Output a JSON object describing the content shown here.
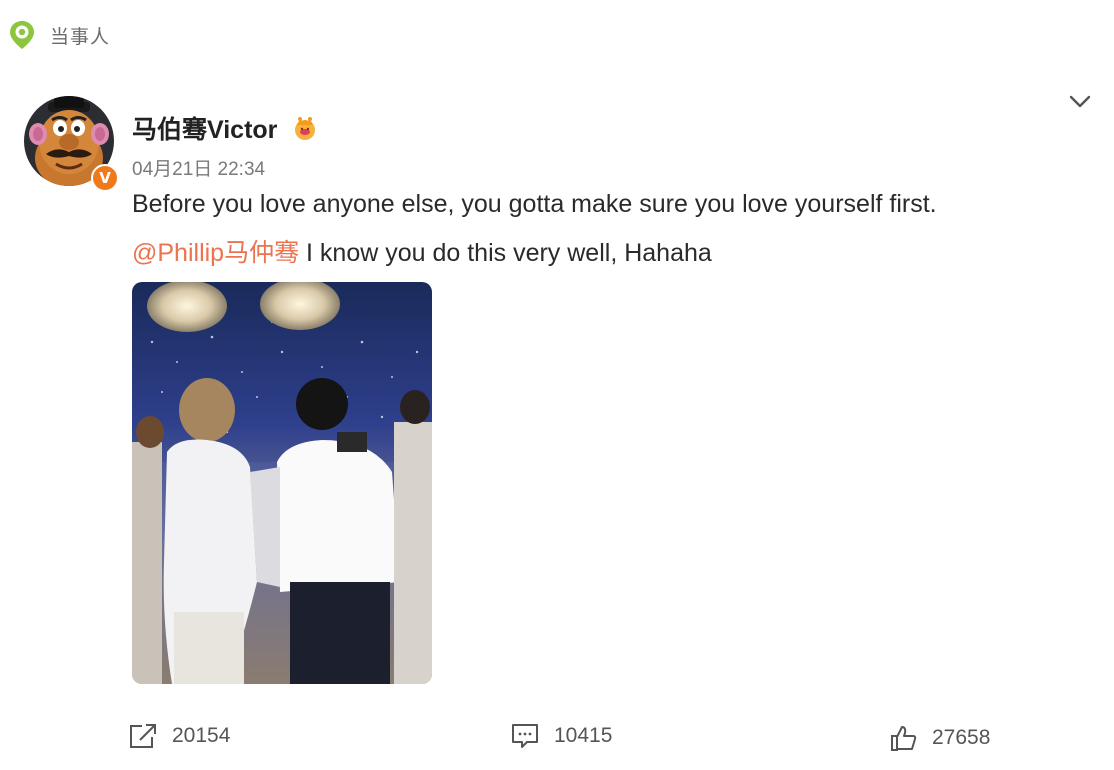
{
  "header": {
    "label": "当事人",
    "location_icon": "location-pin-icon"
  },
  "post": {
    "author": "马伯骞Victor",
    "verified_badge": "V",
    "timestamp": "04月21日 22:34",
    "text_line1": "Before you love anyone else, you gotta make sure you love yourself first.",
    "mention": "@Phillip马仲骞",
    "text_line2": " I know you do this very well, Hahaha"
  },
  "actions": {
    "repost_count": "20154",
    "comment_count": "10415",
    "like_count": "27658"
  },
  "colors": {
    "mention": "#eb7350",
    "badge": "#f07a1a",
    "location_icon": "#8cc63f"
  }
}
